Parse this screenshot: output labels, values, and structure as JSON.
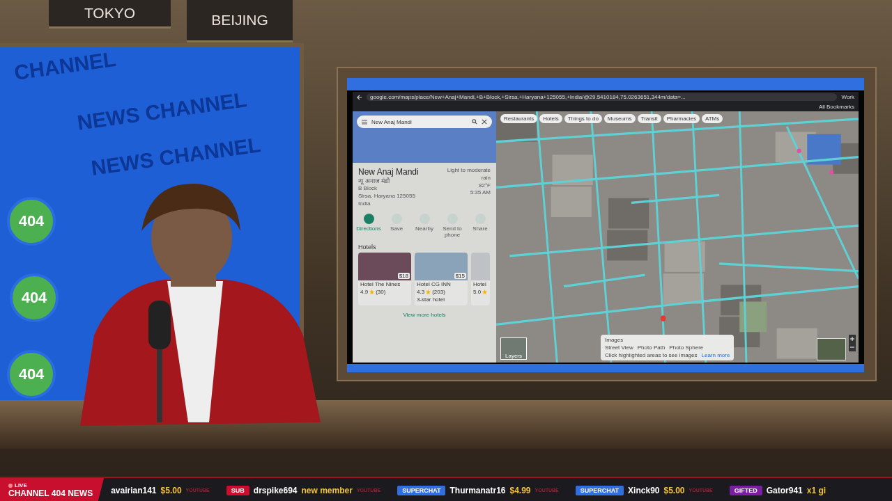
{
  "city_signs": [
    {
      "label": "TOKYO"
    },
    {
      "label": "BEIJING"
    }
  ],
  "wall_screen": {
    "texts": [
      "CHANNEL",
      "NEWS CHANNEL",
      "NEWS CHANNEL"
    ],
    "logos": [
      "404",
      "404",
      "404"
    ]
  },
  "browser": {
    "url": "google.com/maps/place/New+Anaj+Mandi,+B+Block,+Sirsa,+Haryana+125055,+India/@29.5410184,75.0263651,344m/data=...",
    "profile": "Work",
    "bookmarks_label": "All Bookmarks"
  },
  "maps": {
    "search": {
      "value": "New Anaj Mandi"
    },
    "place": {
      "name": "New Anaj Mandi",
      "local_name": "न्यू अनाज मंडी",
      "address_lines": [
        "B Block",
        "Sirsa, Haryana 125055",
        "India"
      ],
      "weather": "Light to moderate rain",
      "temperature": "82°F",
      "time": "5:35 AM"
    },
    "actions": [
      {
        "label": "Directions",
        "selected": true
      },
      {
        "label": "Save",
        "selected": false
      },
      {
        "label": "Nearby",
        "selected": false
      },
      {
        "label": "Send to phone",
        "selected": false
      },
      {
        "label": "Share",
        "selected": false
      }
    ],
    "hotels_heading": "Hotels",
    "hotels": [
      {
        "name": "Hotel The Nines",
        "price": "$18",
        "rating": "4.9",
        "reviews": "(30)"
      },
      {
        "name": "Hotel CG INN",
        "price": "$15",
        "rating": "4.3",
        "reviews": "(203)",
        "note": "3-star hotel"
      },
      {
        "name": "Hotel",
        "rating": "5.0"
      }
    ],
    "view_more": "View more hotels",
    "chips": [
      "Restaurants",
      "Hotels",
      "Things to do",
      "Museums",
      "Transit",
      "Pharmacies",
      "ATMs"
    ],
    "images_panel": {
      "title": "Images",
      "options": [
        "Street View",
        "Photo Path",
        "Photo Sphere"
      ],
      "hint": "Click highlighted areas to see images",
      "link": "Learn more"
    },
    "layers_label": "Layers"
  },
  "ticker": {
    "live": "LIVE",
    "brand": "CHANNEL 404 NEWS",
    "items": [
      {
        "kind": "tip",
        "name": "avairian141",
        "amount": "$5.00",
        "source": "YOUTUBE"
      },
      {
        "kind": "badge",
        "badge": "SUB",
        "color": "#c8102e",
        "name": "drspike694",
        "amount": "new member",
        "source": "YOUTUBE"
      },
      {
        "kind": "badge",
        "badge": "SUPERCHAT",
        "color": "#2f6fe0",
        "name": "Thurmanatr16",
        "amount": "$4.99",
        "source": "YOUTUBE"
      },
      {
        "kind": "badge",
        "badge": "SUPERCHAT",
        "color": "#2f6fe0",
        "name": "Xinck90",
        "amount": "$5.00",
        "source": "YOUTUBE"
      },
      {
        "kind": "badge",
        "badge": "GIFTED",
        "color": "#7b1fa2",
        "name": "Gator941",
        "amount": "x1 gi"
      }
    ]
  }
}
